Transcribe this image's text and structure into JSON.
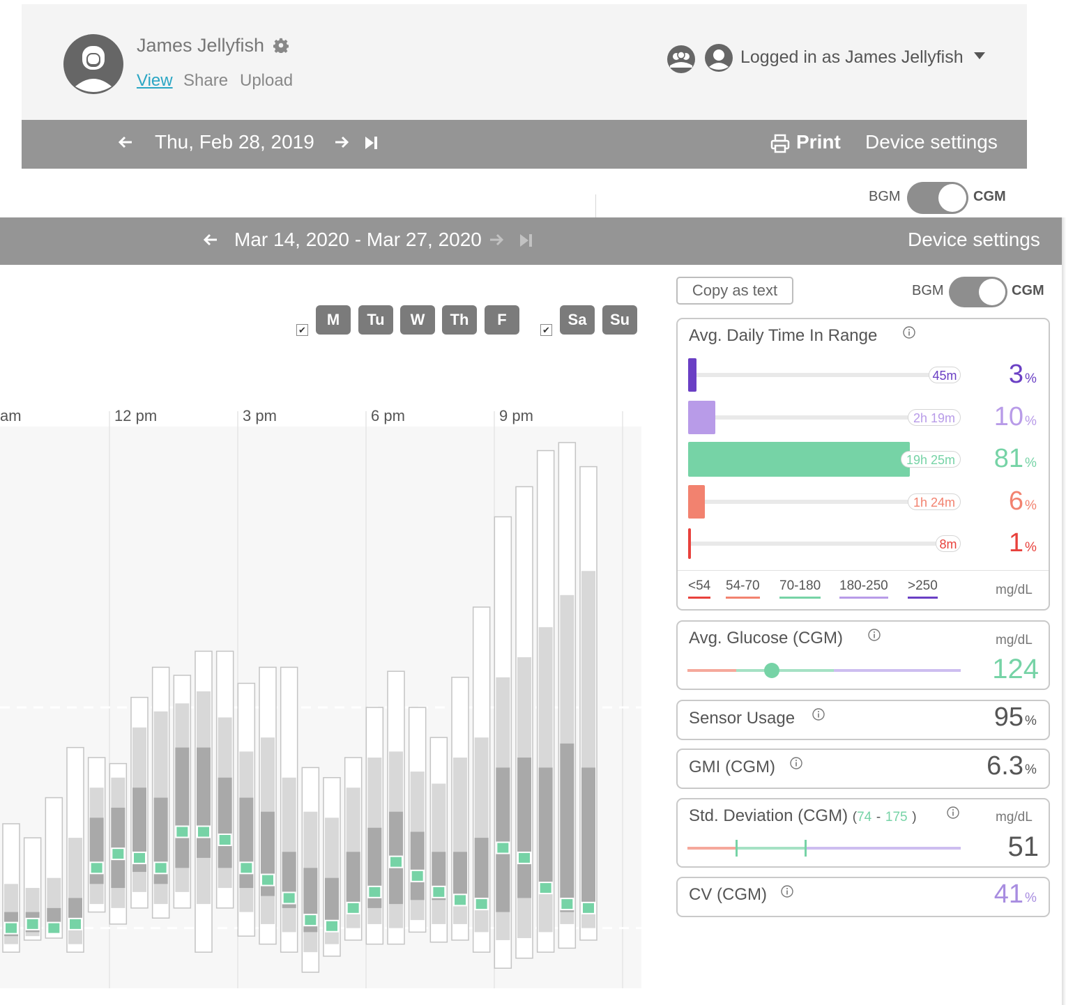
{
  "back_screen": {
    "patient": {
      "name": "James Jellyfish"
    },
    "nav": {
      "view": "View",
      "share": "Share",
      "upload": "Upload"
    },
    "login": {
      "prefix": "Logged in as",
      "user": "James Jellyfish"
    },
    "date_bar": {
      "date": "Thu, Feb 28, 2019",
      "print": "Print",
      "device_settings": "Device settings"
    },
    "toggle": {
      "left": "BGM",
      "right": "CGM"
    }
  },
  "front_screen": {
    "date_bar": {
      "date": "Mar 14, 2020 - Mar 27, 2020",
      "device_settings": "Device settings"
    },
    "weekdays": [
      "M",
      "Tu",
      "W",
      "Th",
      "F"
    ],
    "weekends": [
      "Sa",
      "Su"
    ],
    "copy_button": "Copy as text",
    "toggle": {
      "left": "BGM",
      "right": "CGM"
    }
  },
  "stats": {
    "time_in_range": {
      "title": "Avg. Daily Time In Range",
      "rows": [
        {
          "duration": "45m",
          "value": "3",
          "pct": "%",
          "fraction": 0.03,
          "color": "#6a3fc4"
        },
        {
          "duration": "2h 19m",
          "value": "10",
          "pct": "%",
          "fraction": 0.1,
          "color": "#b89be8"
        },
        {
          "duration": "19h 25m",
          "value": "81",
          "pct": "%",
          "fraction": 0.81,
          "color": "#76d3a6"
        },
        {
          "duration": "1h 24m",
          "value": "6",
          "pct": "%",
          "fraction": 0.06,
          "color": "#f2826f"
        },
        {
          "duration": "8m",
          "value": "1",
          "pct": "%",
          "fraction": 0.01,
          "color": "#e8413c"
        }
      ],
      "ranges": [
        {
          "label": "<54",
          "color": "#e8413c"
        },
        {
          "label": "54-70",
          "color": "#f2826f"
        },
        {
          "label": "70-180",
          "color": "#76d3a6"
        },
        {
          "label": "180-250",
          "color": "#b89be8"
        },
        {
          "label": ">250",
          "color": "#6a3fc4"
        }
      ],
      "unit": "mg/dL"
    },
    "avg_glucose": {
      "title": "Avg. Glucose (CGM)",
      "unit": "mg/dL",
      "value": "124",
      "color": "#76d3a6"
    },
    "sensor_usage": {
      "title": "Sensor Usage",
      "value": "95",
      "pct": "%"
    },
    "gmi": {
      "title": "GMI (CGM)",
      "value": "6.3",
      "pct": "%"
    },
    "std_dev": {
      "title": "Std. Deviation (CGM)",
      "paren_open": "(",
      "low": "74",
      "dash": "-",
      "high": "175",
      "paren_close": ")",
      "unit": "mg/dL",
      "value": "51"
    },
    "cv": {
      "title": "CV (CGM)",
      "value": "41",
      "pct": "%",
      "color": "#a88de0"
    }
  },
  "colors": {
    "bar_gray": "#959595",
    "target_green": "#76d3a6",
    "link_blue": "#2aa6c4"
  },
  "chart_data": {
    "type": "box",
    "x_ticks": [
      "am",
      "12 pm",
      "3 pm",
      "6 pm",
      "9 pm"
    ],
    "xlim_hours": [
      9,
      24
    ],
    "columns": [
      {
        "hour": 9.25,
        "min": 62,
        "p10": 66,
        "p25": 70,
        "median": 72,
        "p75": 82,
        "p90": 92,
        "max": 120
      },
      {
        "hour": 9.75,
        "min": 58,
        "p10": 62,
        "p25": 66,
        "median": 70,
        "p75": 78,
        "p90": 92,
        "max": 122
      },
      {
        "hour": 10.25,
        "min": 64,
        "p10": 66,
        "p25": 68,
        "median": 72,
        "p75": 78,
        "p90": 90,
        "max": 115
      },
      {
        "hour": 10.75,
        "min": 65,
        "p10": 68,
        "p25": 70,
        "median": 70,
        "p75": 80,
        "p90": 95,
        "max": 135
      },
      {
        "hour": 11.25,
        "min": 58,
        "p10": 62,
        "p25": 70,
        "median": 72,
        "p75": 85,
        "p90": 115,
        "max": 160
      },
      {
        "hour": 11.75,
        "min": 78,
        "p10": 82,
        "p25": 92,
        "median": 100,
        "p75": 125,
        "p90": 140,
        "max": 155
      },
      {
        "hour": 12.25,
        "min": 72,
        "p10": 80,
        "p25": 90,
        "median": 107,
        "p75": 130,
        "p90": 145,
        "max": 152
      },
      {
        "hour": 12.75,
        "min": 80,
        "p10": 88,
        "p25": 98,
        "median": 105,
        "p75": 140,
        "p90": 170,
        "max": 185
      },
      {
        "hour": 13.25,
        "min": 75,
        "p10": 82,
        "p25": 92,
        "median": 100,
        "p75": 135,
        "p90": 178,
        "max": 200
      },
      {
        "hour": 13.75,
        "min": 80,
        "p10": 88,
        "p25": 100,
        "median": 118,
        "p75": 160,
        "p90": 182,
        "max": 196
      },
      {
        "hour": 14.25,
        "min": 58,
        "p10": 82,
        "p25": 105,
        "median": 118,
        "p75": 160,
        "p90": 188,
        "max": 208
      },
      {
        "hour": 14.75,
        "min": 80,
        "p10": 90,
        "p25": 100,
        "median": 114,
        "p75": 145,
        "p90": 175,
        "max": 208
      },
      {
        "hour": 15.25,
        "min": 66,
        "p10": 78,
        "p25": 90,
        "median": 100,
        "p75": 135,
        "p90": 158,
        "max": 192
      },
      {
        "hour": 15.75,
        "min": 62,
        "p10": 72,
        "p25": 86,
        "median": 94,
        "p75": 128,
        "p90": 165,
        "max": 200
      },
      {
        "hour": 16.25,
        "min": 58,
        "p10": 68,
        "p25": 80,
        "median": 85,
        "p75": 108,
        "p90": 145,
        "max": 200
      },
      {
        "hour": 16.75,
        "min": 48,
        "p10": 58,
        "p25": 68,
        "median": 74,
        "p75": 100,
        "p90": 128,
        "max": 150
      },
      {
        "hour": 17.25,
        "min": 56,
        "p10": 62,
        "p25": 70,
        "median": 71,
        "p75": 95,
        "p90": 125,
        "max": 145
      },
      {
        "hour": 17.75,
        "min": 64,
        "p10": 70,
        "p25": 77,
        "median": 80,
        "p75": 108,
        "p90": 140,
        "max": 155
      },
      {
        "hour": 18.25,
        "min": 62,
        "p10": 72,
        "p25": 80,
        "median": 88,
        "p75": 120,
        "p90": 155,
        "max": 180
      },
      {
        "hour": 18.75,
        "min": 62,
        "p10": 70,
        "p25": 82,
        "median": 103,
        "p75": 128,
        "p90": 158,
        "max": 198
      },
      {
        "hour": 19.25,
        "min": 68,
        "p10": 74,
        "p25": 84,
        "median": 96,
        "p75": 118,
        "p90": 148,
        "max": 180
      },
      {
        "hour": 19.75,
        "min": 63,
        "p10": 72,
        "p25": 84,
        "median": 88,
        "p75": 108,
        "p90": 142,
        "max": 165
      },
      {
        "hour": 20.25,
        "min": 64,
        "p10": 72,
        "p25": 82,
        "median": 84,
        "p75": 108,
        "p90": 155,
        "max": 195
      },
      {
        "hour": 20.75,
        "min": 58,
        "p10": 68,
        "p25": 80,
        "median": 82,
        "p75": 115,
        "p90": 165,
        "max": 230
      },
      {
        "hour": 21.25,
        "min": 50,
        "p10": 64,
        "p25": 78,
        "median": 110,
        "p75": 150,
        "p90": 195,
        "max": 275
      },
      {
        "hour": 21.75,
        "min": 55,
        "p10": 65,
        "p25": 85,
        "median": 105,
        "p75": 155,
        "p90": 205,
        "max": 290
      },
      {
        "hour": 22.25,
        "min": 58,
        "p10": 68,
        "p25": 88,
        "median": 90,
        "p75": 150,
        "p90": 220,
        "max": 308
      },
      {
        "hour": 22.75,
        "min": 60,
        "p10": 72,
        "p25": 78,
        "median": 82,
        "p75": 162,
        "p90": 236,
        "max": 312
      },
      {
        "hour": 23.25,
        "min": 64,
        "p10": 70,
        "p25": 78,
        "median": 80,
        "p75": 150,
        "p90": 248,
        "max": 300
      }
    ],
    "target_range": [
      70,
      180
    ],
    "ylim": [
      40,
      320
    ]
  }
}
